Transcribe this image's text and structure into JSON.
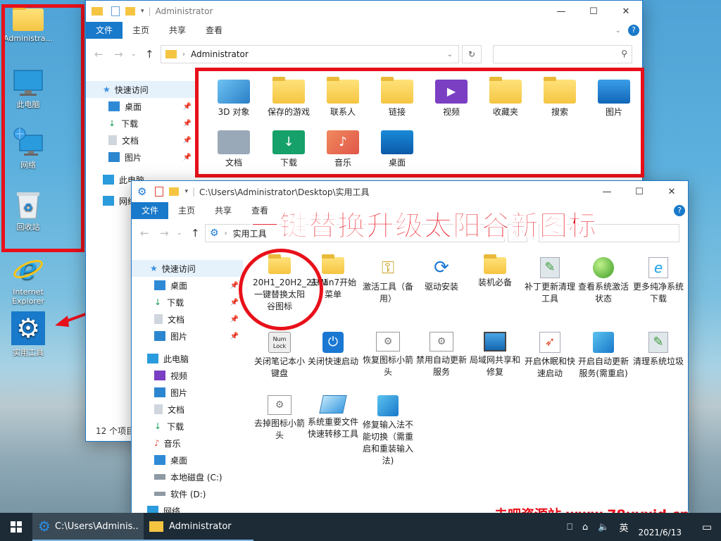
{
  "desktop": {
    "icons": [
      {
        "label": "Administra..."
      },
      {
        "label": "此电脑"
      },
      {
        "label": "网络"
      },
      {
        "label": "回收站"
      },
      {
        "label": "Internet Explorer"
      },
      {
        "label": "实用工具"
      }
    ]
  },
  "back_window": {
    "title": "Administrator",
    "ribbon": [
      "文件",
      "主页",
      "共享",
      "查看"
    ],
    "address": "Administrator",
    "sidebar": [
      {
        "label": "快速访问"
      },
      {
        "label": "桌面"
      },
      {
        "label": "下载"
      },
      {
        "label": "文档"
      },
      {
        "label": "图片"
      },
      {
        "label": "此电脑"
      },
      {
        "label": "网络"
      }
    ],
    "items": [
      {
        "label": "3D 对象"
      },
      {
        "label": "保存的游戏"
      },
      {
        "label": "联系人"
      },
      {
        "label": "链接"
      },
      {
        "label": "视频"
      },
      {
        "label": "收藏夹"
      },
      {
        "label": "搜索"
      },
      {
        "label": "图片"
      },
      {
        "label": "文档"
      },
      {
        "label": "下载"
      },
      {
        "label": "音乐"
      },
      {
        "label": "桌面"
      }
    ],
    "status": "12 个项目"
  },
  "front_window": {
    "title": "C:\\Users\\Administrator\\Desktop\\实用工具",
    "ribbon": [
      "文件",
      "主页",
      "共享",
      "查看"
    ],
    "address": "实用工具",
    "sidebar": [
      {
        "label": "快速访问"
      },
      {
        "label": "桌面"
      },
      {
        "label": "下载"
      },
      {
        "label": "文档"
      },
      {
        "label": "图片"
      },
      {
        "label": "此电脑"
      },
      {
        "label": "视频"
      },
      {
        "label": "图片"
      },
      {
        "label": "文档"
      },
      {
        "label": "下载"
      },
      {
        "label": "音乐"
      },
      {
        "label": "桌面"
      },
      {
        "label": "本地磁盘 (C:)"
      },
      {
        "label": "软件 (D:)"
      },
      {
        "label": "网络"
      }
    ],
    "items": [
      {
        "label": "20H1_20H2_21H1一键替换太阳谷图标"
      },
      {
        "label": "去Win7开始菜单"
      },
      {
        "label": "激活工具（备用）"
      },
      {
        "label": "驱动安装"
      },
      {
        "label": "装机必备"
      },
      {
        "label": "补丁更新清理工具"
      },
      {
        "label": "查看系统激活状态"
      },
      {
        "label": "更多纯净系统下载"
      },
      {
        "label": "关闭笔记本小键盘"
      },
      {
        "label": "关闭快速启动"
      },
      {
        "label": "恢复图标小箭头"
      },
      {
        "label": "禁用自动更新服务"
      },
      {
        "label": "局域网共享和修复"
      },
      {
        "label": "开启休眠和快速启动"
      },
      {
        "label": "开启自动更新服务(需重启)"
      },
      {
        "label": "清理系统垃圾"
      },
      {
        "label": "去掉图标小箭头"
      },
      {
        "label": "系统重要文件快速转移工具"
      },
      {
        "label": "修复输入法不能切换（需重启和重装输入法)"
      }
    ],
    "num_lock_label": "Num Lock"
  },
  "overlay": {
    "headline": "一键替换升级太阳谷新图标",
    "watermark": "去吧资源站 www.78uyxjd.cn"
  },
  "taskbar": {
    "buttons": [
      {
        "label": "C:\\Users\\Adminis..."
      },
      {
        "label": "Administrator"
      }
    ],
    "ime": "英",
    "date": "2021/6/13"
  },
  "colors": {
    "accent": "#1979ca",
    "highlight_red": "#e8101a",
    "taskbar": "#1d2b36"
  }
}
